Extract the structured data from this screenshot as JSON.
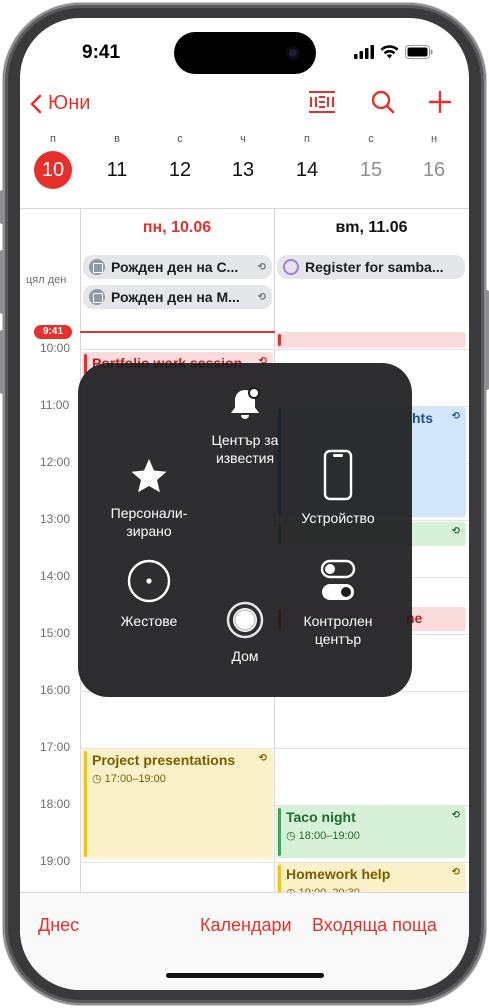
{
  "status": {
    "time": "9:41"
  },
  "nav": {
    "back_label": "Юни"
  },
  "week": {
    "days": [
      {
        "letter": "п",
        "num": "10"
      },
      {
        "letter": "в",
        "num": "11"
      },
      {
        "letter": "с",
        "num": "12"
      },
      {
        "letter": "ч",
        "num": "13"
      },
      {
        "letter": "п",
        "num": "14"
      },
      {
        "letter": "с",
        "num": "15"
      },
      {
        "letter": "н",
        "num": "16"
      }
    ]
  },
  "grid": {
    "day1_header": "пн, 10.06",
    "day2_header": "вm, 11.06",
    "allday_label": "цял ден",
    "allday_events": [
      {
        "title": "Рожден ден на С..."
      },
      {
        "title": "Рожден ден на М..."
      },
      {
        "title": "Register for samba..."
      }
    ],
    "now_label": "9:41",
    "hours": [
      "10:00",
      "11:00",
      "12:00",
      "13:00",
      "14:00",
      "15:00",
      "16:00",
      "17:00",
      "18:00",
      "19:00"
    ],
    "events": {
      "portfolio": {
        "title": "Portfolio work session"
      },
      "hts": {
        "title": "hts"
      },
      "ne": {
        "title": "ne"
      },
      "project": {
        "title": "Project presentations",
        "time": "17:00–19:00"
      },
      "taco": {
        "title": "Taco night",
        "time": "18:00–19:00"
      },
      "homework": {
        "title": "Homework help",
        "time": "19:00–20:30"
      }
    }
  },
  "assistive_touch": {
    "notification_center": "Център за известия",
    "custom": "Персонали-зирано",
    "device": "Устройство",
    "gestures": "Жестове",
    "control_center": "Контролен център",
    "home": "Дом"
  },
  "toolbar": {
    "today": "Днес",
    "calendars": "Календари",
    "inbox": "Входяща поща"
  },
  "colors": {
    "accent": "#e8302a"
  }
}
